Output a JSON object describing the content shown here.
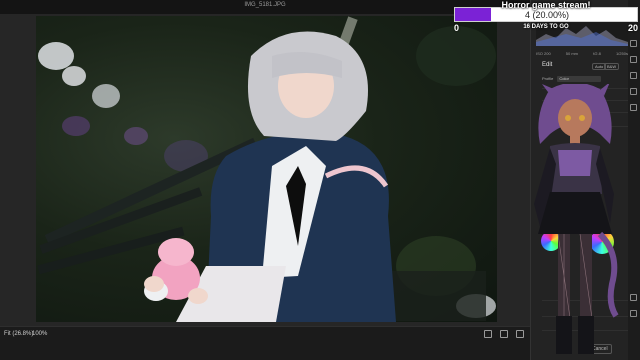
{
  "document": {
    "filename": "IMG_5181.JPG"
  },
  "stream_goal": {
    "title": "Horror game stream!",
    "current_label": "4 (20.00%)",
    "progress_fraction": 0.2,
    "min_label": "0",
    "max_label": "20",
    "days_left": "16 DAYS TO GO",
    "fill_color": "#7b22d6"
  },
  "histogram": {
    "stats": [
      "ISO 200",
      "50 mm",
      "f/2.8",
      "1/250s"
    ]
  },
  "edit_panel": {
    "title": "Edit",
    "auto_label": "Auto",
    "bw_label": "B&W",
    "profile_label": "Profile",
    "profile_value": "Color"
  },
  "statusbar": {
    "fit_label": "Fit (26.8%)",
    "zoom_label": "100%"
  },
  "footer": {
    "cancel_label": "Cancel"
  },
  "icons": [
    "grid-icon",
    "compare-icon",
    "fullscreen-icon",
    "crop-icon",
    "heal-icon",
    "mask-icon",
    "redeye-icon",
    "presets-icon",
    "zoom-icon",
    "hand-icon"
  ]
}
